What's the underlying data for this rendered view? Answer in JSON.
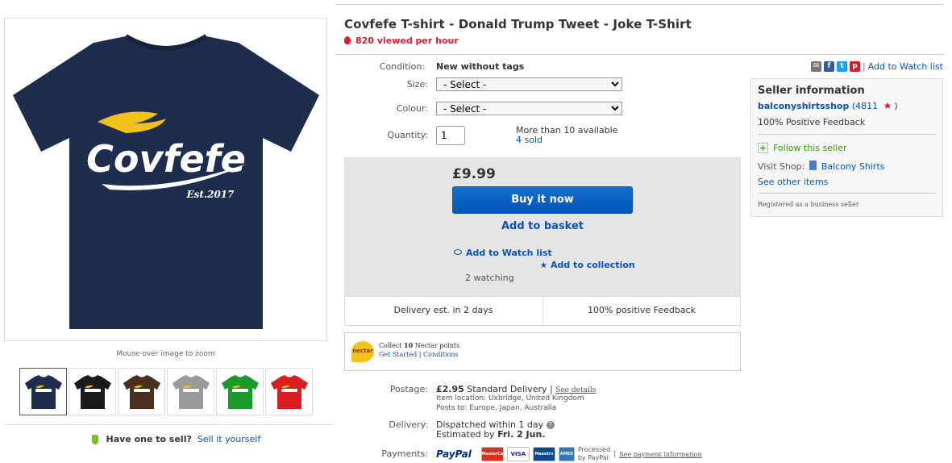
{
  "product": {
    "title": "Covfefe T-shirt - Donald Trump Tweet - Joke T-Shirt",
    "views": "820 viewed per hour",
    "image_text": "Covfefe",
    "image_sub": "Est.2017",
    "zoom_hint": "Mouse over image to zoom",
    "shirt_color": "#1e2d4d",
    "thumbnail_colors": [
      "#1e2d4d",
      "#1a1a1a",
      "#4a2e1e",
      "#9a9a9a",
      "#1a9a2a",
      "#d81e1e"
    ]
  },
  "sell": {
    "prompt": "Have one to sell?",
    "link": "Sell it yourself"
  },
  "details": {
    "condition_label": "Condition:",
    "condition_value": "New without tags",
    "size_label": "Size:",
    "size_placeholder": "- Select -",
    "colour_label": "Colour:",
    "colour_placeholder": "- Select -",
    "quantity_label": "Quantity:",
    "quantity_value": "1",
    "available": "More than 10 available",
    "sold": "4 sold"
  },
  "buy": {
    "price": "£9.99",
    "buy_now": "Buy it now",
    "add_basket": "Add to basket",
    "watch": "Add to Watch list",
    "collection": "Add to collection",
    "watching": "2 watching",
    "delivery_est": "Delivery est. in 2 days",
    "positive_feedback": "100% positive Feedback"
  },
  "nectar": {
    "logo": "nectar",
    "collect_prefix": "Collect",
    "points": "10",
    "collect_suffix": "Nectar points",
    "get_started": "Get Started",
    "separator": "|",
    "conditions": "Conditions"
  },
  "share": {
    "watch_link": "Add to Watch list",
    "separator": "|",
    "icons": [
      "email-icon",
      "facebook-icon",
      "twitter-icon",
      "pinterest-icon"
    ],
    "colors": {
      "email": "#777777",
      "facebook": "#3b5998",
      "twitter": "#1da1f2",
      "pinterest": "#cb2027"
    }
  },
  "seller": {
    "heading": "Seller information",
    "name": "balconyshirtsshop",
    "score": "(4811",
    "score_close": ")",
    "feedback": "100% Positive Feedback",
    "follow": "Follow this seller",
    "visit_label": "Visit Shop:",
    "shop_name": "Balcony Shirts",
    "other_items": "See other items",
    "registered": "Registered as a business seller"
  },
  "postage": {
    "label": "Postage:",
    "price": "£2.95",
    "method": "Standard Delivery",
    "separator": "|",
    "see_details": "See details",
    "location": "Item location:  Uxbridge, United Kingdom",
    "posts_to": "Posts to:  Europe, Japan, Australia"
  },
  "delivery": {
    "label": "Delivery:",
    "dispatch": "Dispatched within 1 day",
    "estimated_prefix": "Estimated by",
    "estimated_date": "Fri. 2 Jun."
  },
  "payments": {
    "label": "Payments:",
    "paypal": "PayPal",
    "cards": [
      "MasterCard",
      "VISA",
      "Maestro",
      "AMEX"
    ],
    "processed": "Processed",
    "by_paypal": "by PayPal",
    "separator": "|",
    "see_info": "See payment information"
  },
  "colors": {
    "accent": "#0654ba",
    "alert": "#dd1e31",
    "follow": "#359b00"
  }
}
